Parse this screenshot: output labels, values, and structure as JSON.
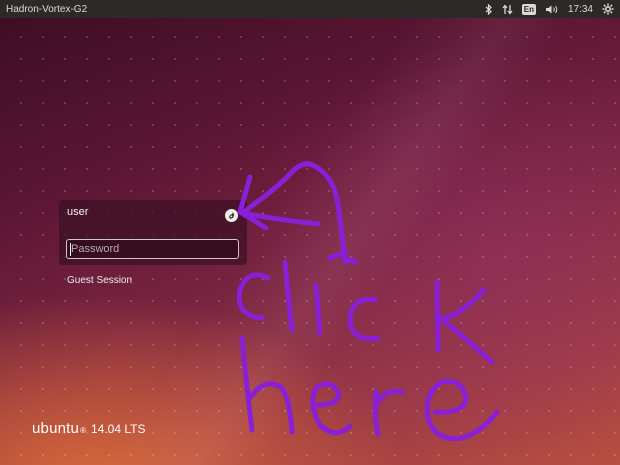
{
  "topbar": {
    "hostname": "Hadron-Vortex-G2",
    "keyboard_layout": "En",
    "clock": "17:34",
    "icons": [
      "bluetooth-icon",
      "network-icon",
      "keyboard-layout-icon",
      "volume-icon",
      "settings-gear-icon"
    ]
  },
  "login": {
    "username": "user",
    "password_placeholder": "Password",
    "session_icon": "session-type-icon",
    "guest_session": "Guest Session"
  },
  "branding": {
    "name": "ubuntu",
    "registered": "®",
    "version": "14.04 LTS"
  },
  "annotation": {
    "color": "#8a1fd8",
    "line1": "click",
    "line2": "here",
    "arrow": "arrow-pointing-to-session-icon"
  },
  "colors": {
    "topbar": "#2b2a27",
    "panel": "#3c1024"
  }
}
